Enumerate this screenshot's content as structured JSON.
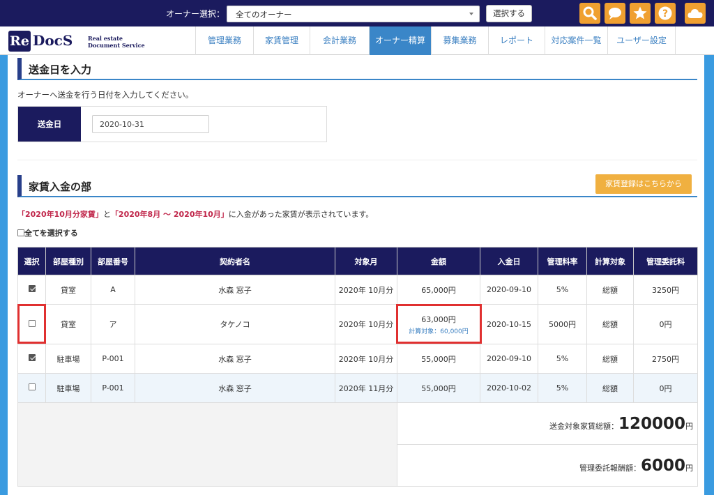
{
  "topbar": {
    "owner_label": "オーナー選択：",
    "owner_select_value": "全てのオーナー",
    "select_button": "選択する"
  },
  "logo": {
    "re": "Re",
    "docs": "DocS",
    "sub_line1": "Real estate",
    "sub_line2": "Document Service"
  },
  "nav": [
    {
      "label": "管理業務"
    },
    {
      "label": "家賃管理"
    },
    {
      "label": "会計業務"
    },
    {
      "label": "オーナー精算"
    },
    {
      "label": "募集業務"
    },
    {
      "label": "レポート"
    },
    {
      "label": "対応案件一覧"
    },
    {
      "label": "ユーザー設定"
    }
  ],
  "send_section": {
    "title": "送金日を入力",
    "description": "オーナーへ送金を行う日付を入力してください。",
    "date_label": "送金日",
    "date_value": "2020-10-31"
  },
  "rent_section": {
    "title": "家賃入金の部",
    "register_button": "家賃登録はこちらから",
    "notice_red1": "「2020年10月分家賃」",
    "notice_mid": "と",
    "notice_red2": "「2020年8月 ～ 2020年10月」",
    "notice_tail": "に入金があった家賃が表示されています。",
    "select_all": "全てを選択する"
  },
  "table": {
    "headers": [
      "選択",
      "部屋種別",
      "部屋番号",
      "契約者名",
      "対象月",
      "金額",
      "入金日",
      "管理料率",
      "計算対象",
      "管理委託料"
    ],
    "rows": [
      {
        "checked": true,
        "type": "貸室",
        "room": "A",
        "name": "水森 窓子",
        "month": "2020年 10月分",
        "amount": "65,000円",
        "amount_sub": "",
        "date": "2020-09-10",
        "rate": "5%",
        "target": "総額",
        "fee": "3250円"
      },
      {
        "checked": false,
        "type": "貸室",
        "room": "ア",
        "name": "タケノコ",
        "month": "2020年 10月分",
        "amount": "63,000円",
        "amount_sub": "計算対象：60,000円",
        "date": "2020-10-15",
        "rate": "5000円",
        "target": "総額",
        "fee": "0円"
      },
      {
        "checked": true,
        "type": "駐車場",
        "room": "P-001",
        "name": "水森 窓子",
        "month": "2020年 10月分",
        "amount": "55,000円",
        "amount_sub": "",
        "date": "2020-09-10",
        "rate": "5%",
        "target": "総額",
        "fee": "2750円"
      },
      {
        "checked": false,
        "type": "駐車場",
        "room": "P-001",
        "name": "水森 窓子",
        "month": "2020年 11月分",
        "amount": "55,000円",
        "amount_sub": "",
        "date": "2020-10-02",
        "rate": "5%",
        "target": "総額",
        "fee": "0円"
      }
    ],
    "total_rent_label": "送金対象家賃総額：",
    "total_rent_value": "120000",
    "total_fee_label": "管理委託報酬額：",
    "total_fee_value": "6000",
    "unit": "円"
  },
  "icons": [
    "search-icon",
    "chat-icon",
    "star-icon",
    "help-icon",
    "cloud-icon"
  ],
  "colors": {
    "navy": "#1b1b5e",
    "accent": "#f0a030",
    "highlight": "#e03030",
    "active_tab": "#3a86c8"
  }
}
